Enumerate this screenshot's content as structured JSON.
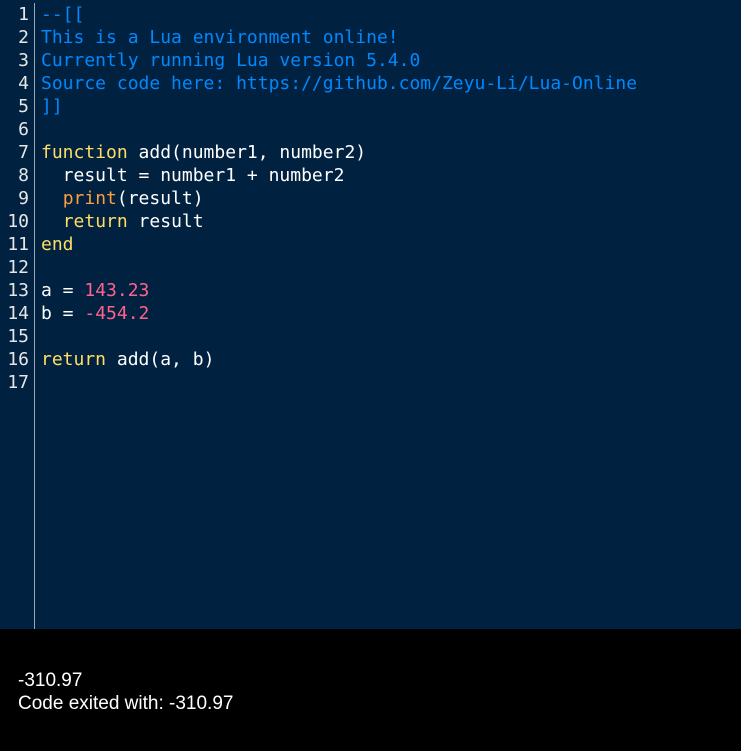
{
  "colors": {
    "editor_bg": "#002240",
    "console_bg": "#000000",
    "comment": "#0088ff",
    "keyword": "#ffdd66",
    "builtin": "#ff9d3f",
    "number": "#ff628c",
    "text": "#ffffff"
  },
  "editor": {
    "line_numbers": [
      "1",
      "2",
      "3",
      "4",
      "5",
      "6",
      "7",
      "8",
      "9",
      "10",
      "11",
      "12",
      "13",
      "14",
      "15",
      "16",
      "17"
    ],
    "lines": [
      [
        {
          "t": "comment",
          "v": "--[["
        }
      ],
      [
        {
          "t": "comment",
          "v": "This is a Lua environment online!"
        }
      ],
      [
        {
          "t": "comment",
          "v": "Currently running Lua version 5.4.0"
        }
      ],
      [
        {
          "t": "comment",
          "v": "Source code here: https://github.com/Zeyu-Li/Lua-Online"
        }
      ],
      [
        {
          "t": "comment",
          "v": "]]"
        }
      ],
      [],
      [
        {
          "t": "keyword",
          "v": "function"
        },
        {
          "t": "plain",
          "v": " add(number1, number2)"
        }
      ],
      [
        {
          "t": "plain",
          "v": "  result = number1 + number2"
        }
      ],
      [
        {
          "t": "plain",
          "v": "  "
        },
        {
          "t": "builtin",
          "v": "print"
        },
        {
          "t": "plain",
          "v": "(result)"
        }
      ],
      [
        {
          "t": "plain",
          "v": "  "
        },
        {
          "t": "keyword",
          "v": "return"
        },
        {
          "t": "plain",
          "v": " result"
        }
      ],
      [
        {
          "t": "keyword",
          "v": "end"
        }
      ],
      [],
      [
        {
          "t": "plain",
          "v": "a = "
        },
        {
          "t": "number",
          "v": "143.23"
        }
      ],
      [
        {
          "t": "plain",
          "v": "b = "
        },
        {
          "t": "number",
          "v": "-454.2"
        }
      ],
      [],
      [
        {
          "t": "keyword",
          "v": "return"
        },
        {
          "t": "plain",
          "v": " add(a, b)"
        }
      ],
      []
    ]
  },
  "console": {
    "output_lines": [
      "-310.97",
      "Code exited with: -310.97"
    ]
  }
}
